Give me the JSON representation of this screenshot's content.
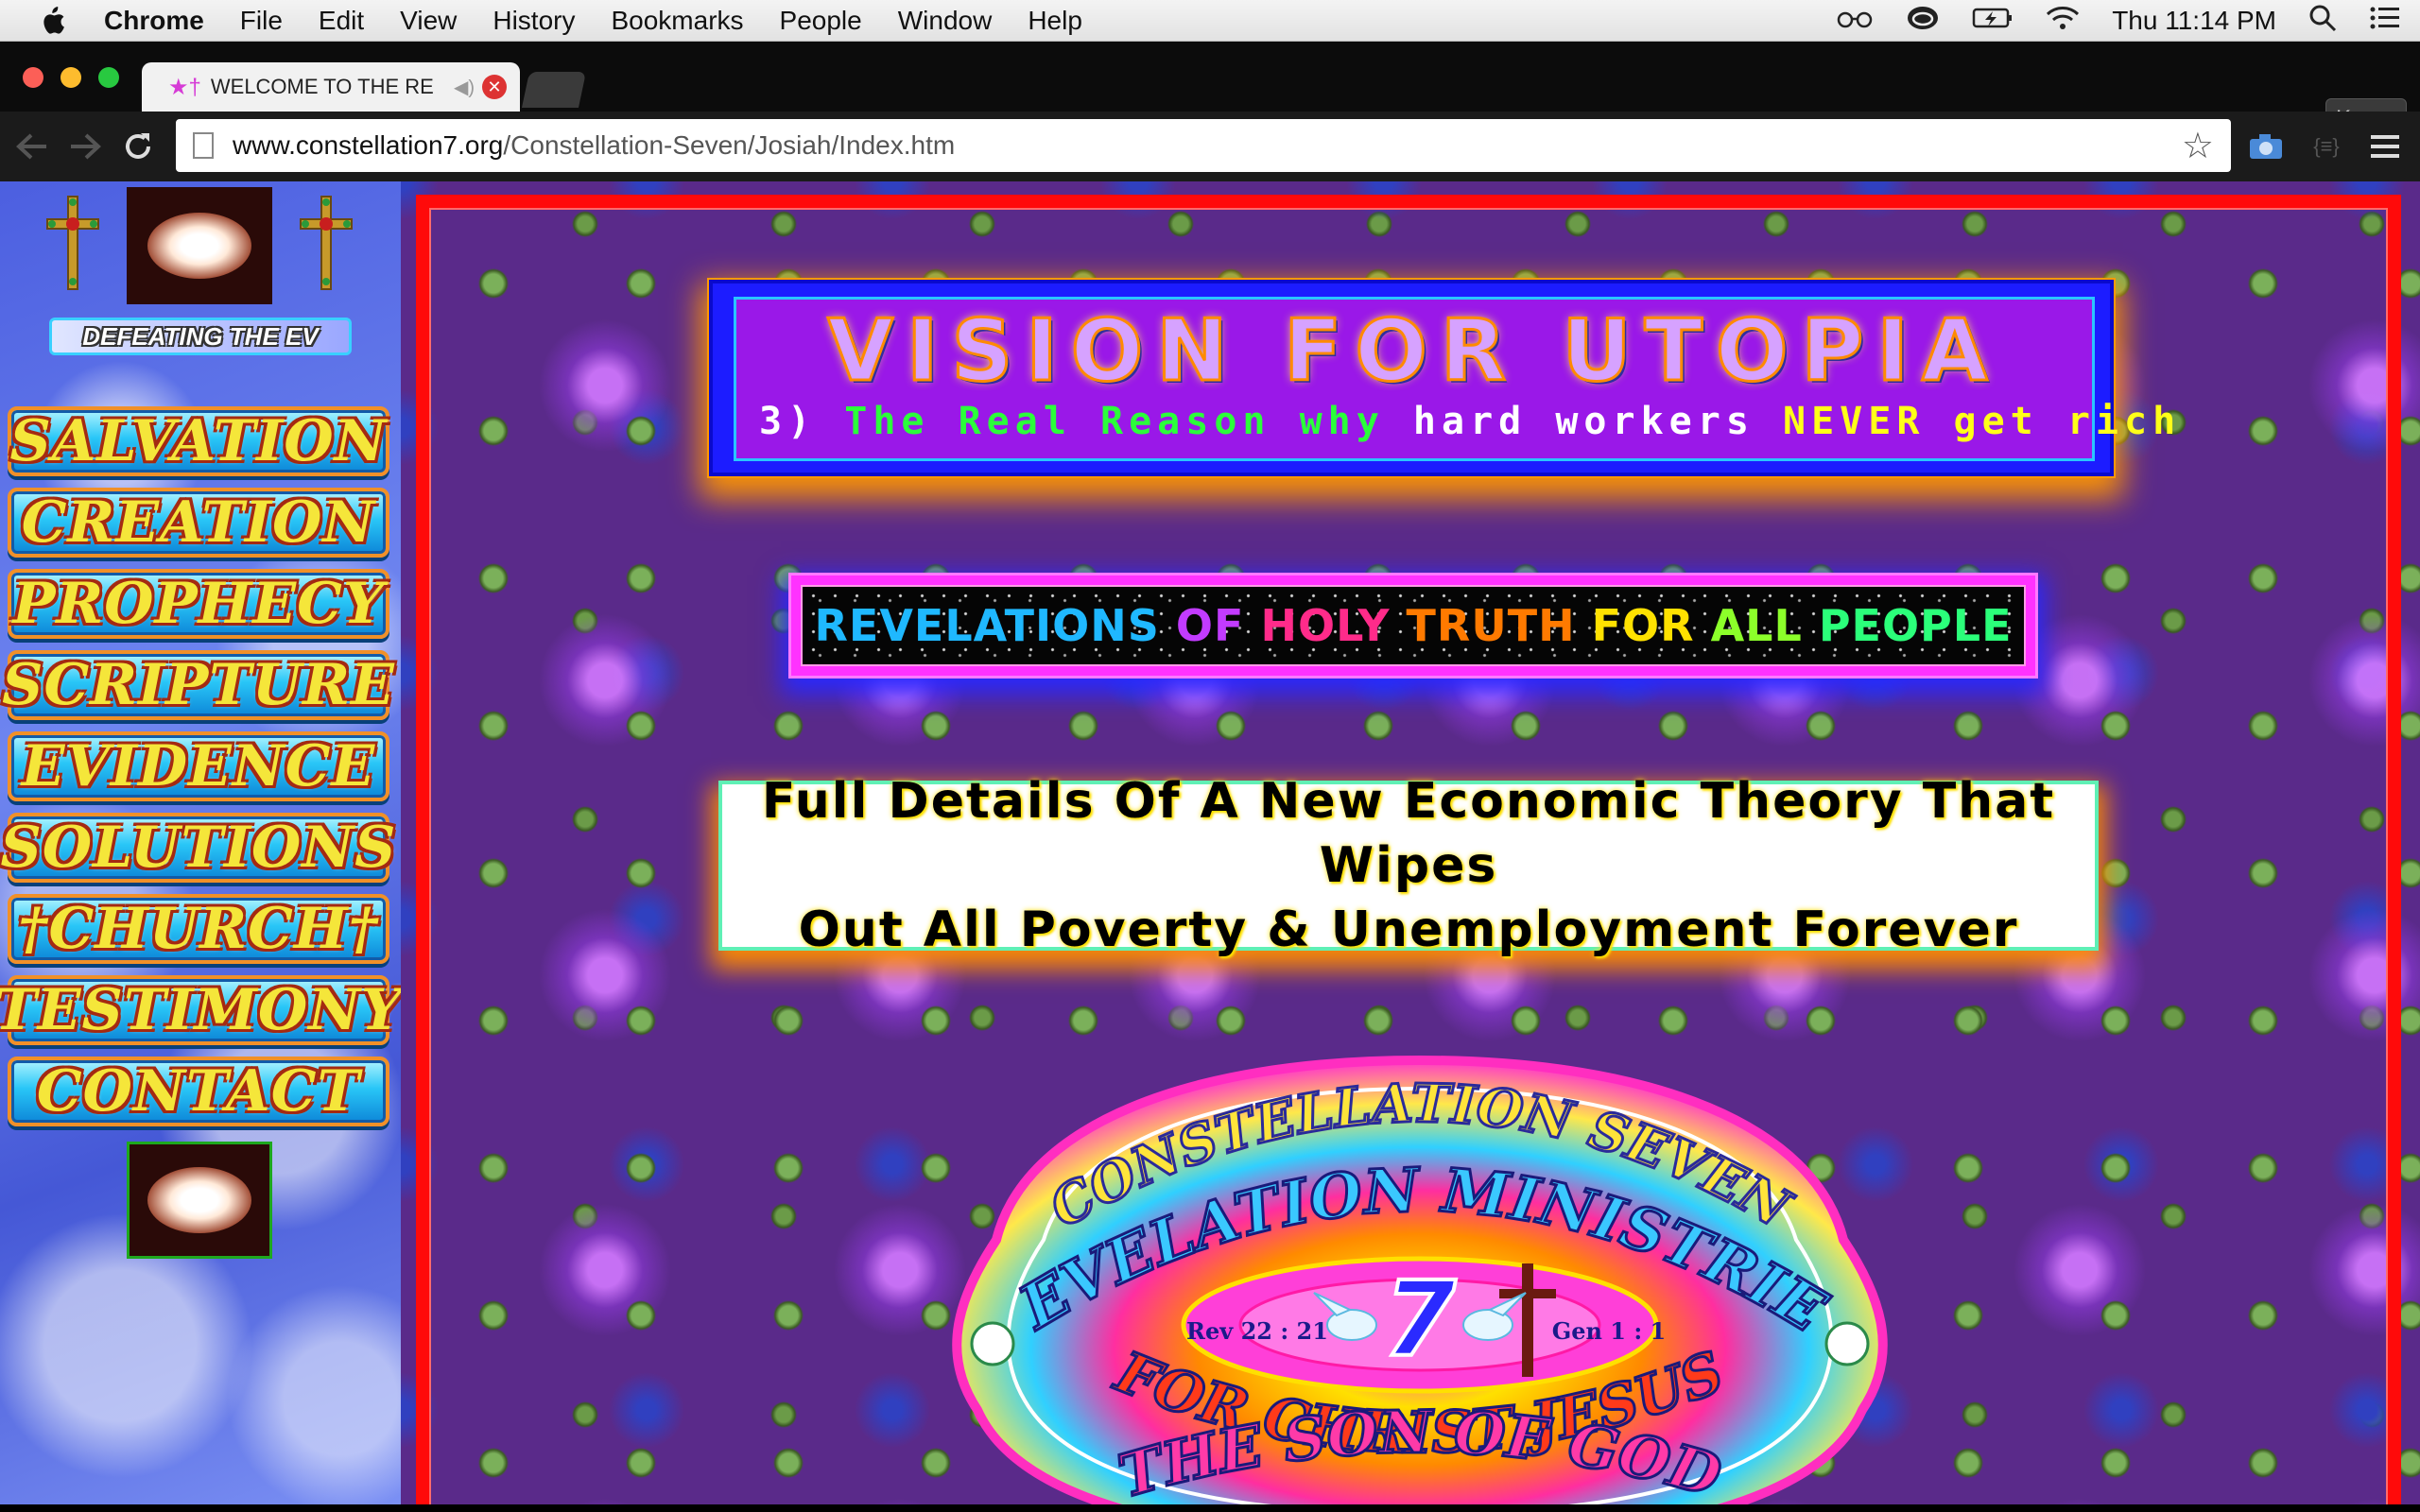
{
  "menubar": {
    "app_name": "Chrome",
    "items": [
      "File",
      "Edit",
      "View",
      "History",
      "Bookmarks",
      "People",
      "Window",
      "Help"
    ],
    "clock": "Thu 11:14 PM"
  },
  "browser": {
    "tab_title": "WELCOME TO THE RE",
    "tab_favicon_glyph": "★†",
    "profile_name": "Karen",
    "url_domain": "www.constellation7.org",
    "url_path": "/Constellation-Seven/Josiah/Index.htm"
  },
  "sidebar": {
    "marquee_text": "DEFEATING THE EV",
    "nav_items": [
      {
        "label": "SALVATION"
      },
      {
        "label": "CREATION"
      },
      {
        "label": "PROPHECY"
      },
      {
        "label": "SCRIPTURE"
      },
      {
        "label": "EVIDENCE"
      },
      {
        "label": "SOLUTIONS"
      },
      {
        "label": "†CHURCH†"
      },
      {
        "label": "TESTIMONY"
      },
      {
        "label": "CONTACT"
      }
    ]
  },
  "main": {
    "banner_title": "VISION FOR UTOPIA",
    "banner_subtitle": {
      "number": "3)",
      "part_green": "The Real Reason why",
      "part_white": "hard workers",
      "part_yellow": "NEVER get rich"
    },
    "revelations_words": [
      {
        "text": "REVELATIONS",
        "color": "#1fb8ff"
      },
      {
        "text": "OF",
        "color": "#c23bff"
      },
      {
        "text": "HOLY",
        "color": "#ff2b8a"
      },
      {
        "text": "TRUTH",
        "color": "#ff7a00"
      },
      {
        "text": "FOR",
        "color": "#ffe100"
      },
      {
        "text": "ALL",
        "color": "#8cff2a"
      },
      {
        "text": "PEOPLE",
        "color": "#2bff7a"
      }
    ],
    "description_line1": "Full Details Of A New Economic Theory That Wipes",
    "description_line2": "Out All Poverty & Unemployment Forever",
    "logo": {
      "line1": "CONSTELLATION SEVEN",
      "line2": "REVELATION MINISTRIES",
      "number": "7",
      "left_ref": "Rev 22 : 21",
      "right_ref": "Gen 1 : 1",
      "line3": "FOR CHRIST JESUS",
      "line4": "THE SON OF GOD"
    }
  }
}
